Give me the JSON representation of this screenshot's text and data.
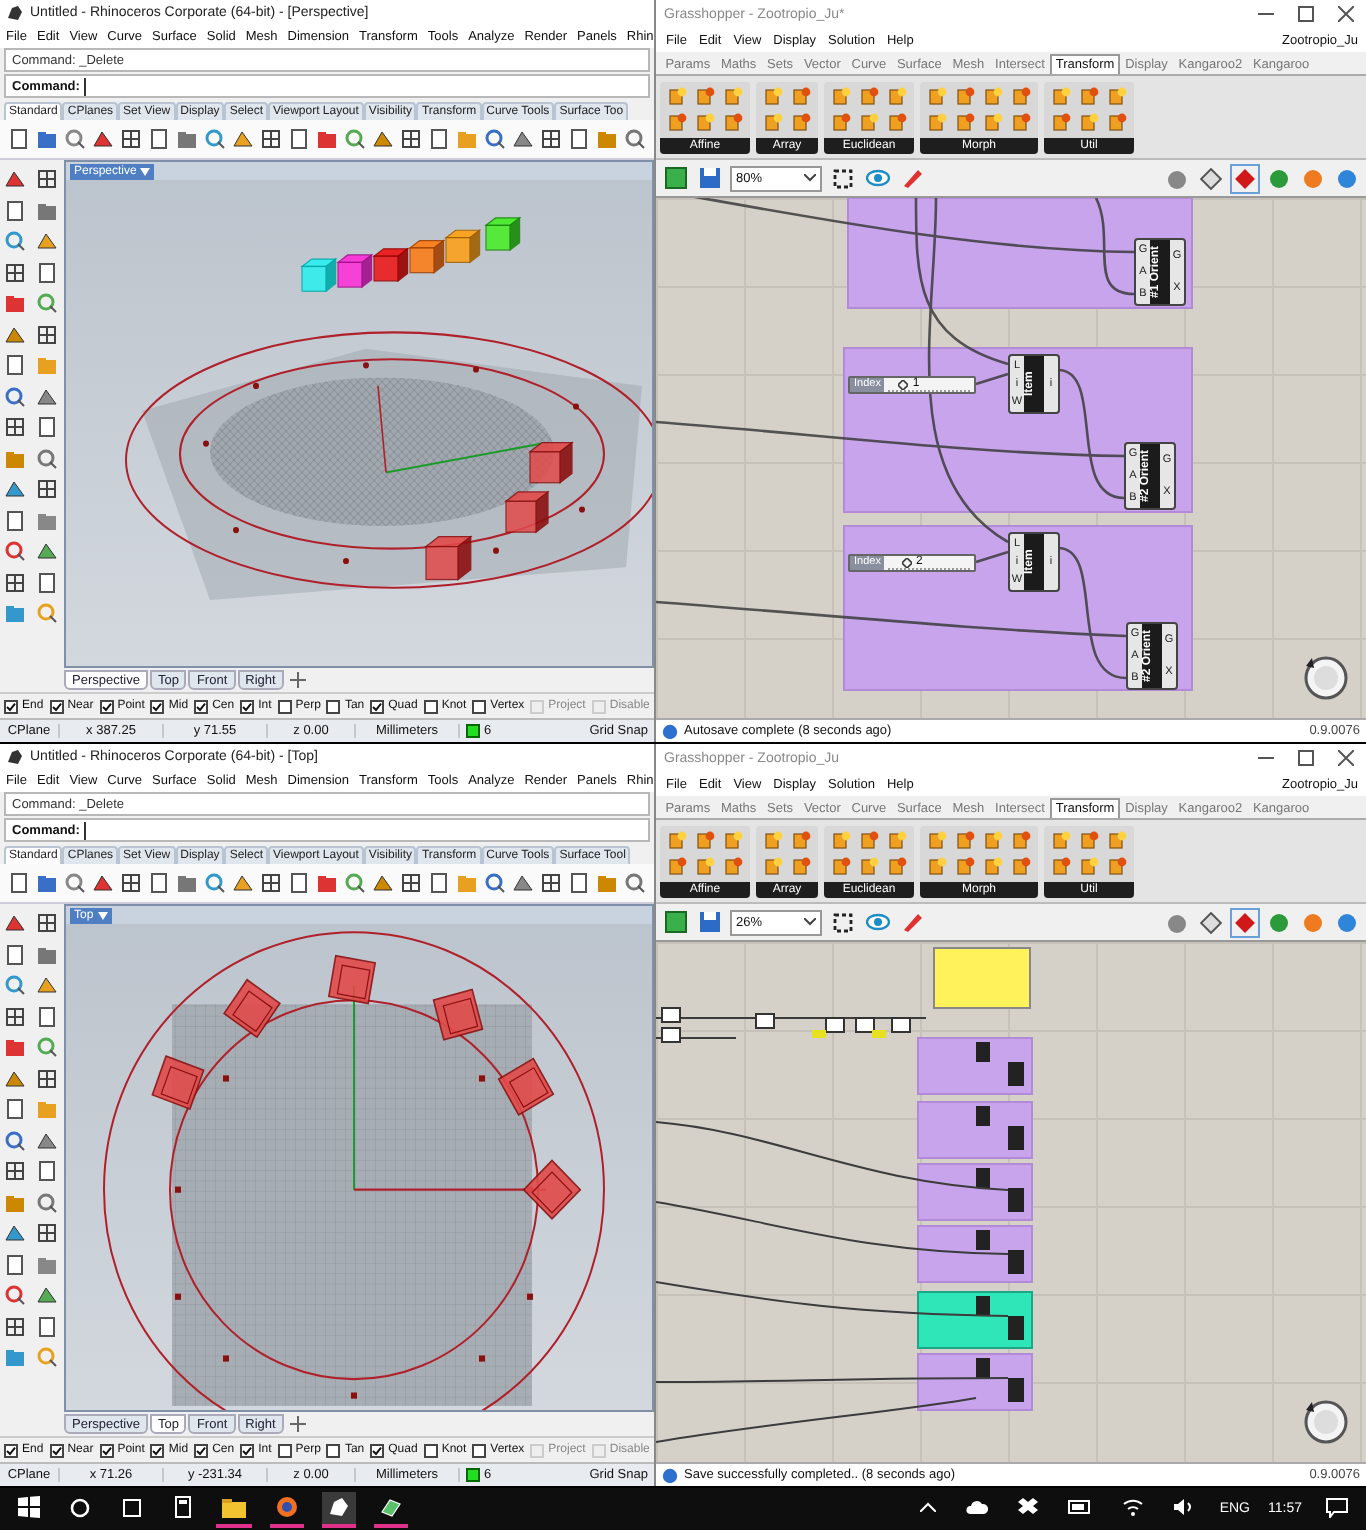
{
  "screens": [
    {
      "rhino": {
        "title": "Untitled - Rhinoceros Corporate (64-bit) - [Perspective]",
        "menu": [
          "File",
          "Edit",
          "View",
          "Curve",
          "Surface",
          "Solid",
          "Mesh",
          "Dimension",
          "Transform",
          "Tools",
          "Analyze",
          "Render",
          "Panels",
          "Rhin"
        ],
        "command_history": "Command: _Delete",
        "command_prompt": "Command:",
        "toolbar_tabs": [
          {
            "label": "Standard",
            "selected": true
          },
          {
            "label": "CPlanes",
            "selected": false
          },
          {
            "label": "Set View",
            "selected": false
          },
          {
            "label": "Display",
            "selected": false
          },
          {
            "label": "Select",
            "selected": false
          },
          {
            "label": "Viewport Layout",
            "selected": false
          },
          {
            "label": "Visibility",
            "selected": false
          },
          {
            "label": "Transform",
            "selected": false
          },
          {
            "label": "Curve Tools",
            "selected": false
          },
          {
            "label": "Surface Too",
            "selected": false
          }
        ],
        "viewport": {
          "kind": "perspective",
          "label": "Perspective"
        },
        "view_tabs": [
          {
            "label": "Perspective",
            "selected": true
          },
          {
            "label": "Top",
            "selected": false
          },
          {
            "label": "Front",
            "selected": false
          },
          {
            "label": "Right",
            "selected": false
          }
        ],
        "osnaps": [
          {
            "label": "End",
            "checked": true,
            "disabled": false
          },
          {
            "label": "Near",
            "checked": true,
            "disabled": false
          },
          {
            "label": "Point",
            "checked": true,
            "disabled": false
          },
          {
            "label": "Mid",
            "checked": true,
            "disabled": false
          },
          {
            "label": "Cen",
            "checked": true,
            "disabled": false
          },
          {
            "label": "Int",
            "checked": true,
            "disabled": false
          },
          {
            "label": "Perp",
            "checked": false,
            "disabled": false
          },
          {
            "label": "Tan",
            "checked": false,
            "disabled": false
          },
          {
            "label": "Quad",
            "checked": true,
            "disabled": false
          },
          {
            "label": "Knot",
            "checked": false,
            "disabled": false
          },
          {
            "label": "Vertex",
            "checked": false,
            "disabled": false
          },
          {
            "label": "Project",
            "checked": false,
            "disabled": true
          },
          {
            "label": "Disable",
            "checked": false,
            "disabled": true
          }
        ],
        "status": {
          "cplane": "CPlane",
          "x": "x 387.25",
          "y": "y 71.55",
          "z": "z 0.00",
          "units": "Millimeters",
          "layer": "6",
          "grid_snap": "Grid Snap"
        }
      },
      "grasshopper": {
        "title": "Grasshopper - Zootropio_Ju*",
        "menu": [
          "File",
          "Edit",
          "View",
          "Display",
          "Solution",
          "Help"
        ],
        "document": "Zootropio_Ju",
        "tabs": [
          {
            "label": "Params",
            "selected": false
          },
          {
            "label": "Maths",
            "selected": false
          },
          {
            "label": "Sets",
            "selected": false
          },
          {
            "label": "Vector",
            "selected": false
          },
          {
            "label": "Curve",
            "selected": false
          },
          {
            "label": "Surface",
            "selected": false
          },
          {
            "label": "Mesh",
            "selected": false
          },
          {
            "label": "Intersect",
            "selected": false
          },
          {
            "label": "Transform",
            "selected": true
          },
          {
            "label": "Display",
            "selected": false
          },
          {
            "label": "Kangaroo2",
            "selected": false
          },
          {
            "label": "Kangaroo",
            "selected": false
          }
        ],
        "panels": [
          "Affine",
          "Array",
          "Euclidean",
          "Morph",
          "Util"
        ],
        "zoom": "80%",
        "canvas": {
          "kind": "detailed",
          "nodes": [
            {
              "kind": "orient",
              "name": "#1 Orient",
              "inputs": [
                "G",
                "A",
                "B"
              ],
              "outputs": [
                "G",
                "X"
              ]
            },
            {
              "kind": "slider",
              "label": "Index",
              "value": "1",
              "level": 0.15
            },
            {
              "kind": "item",
              "name": "Item",
              "inputs": [
                "L",
                "i",
                "W"
              ],
              "outputs": [
                "i"
              ]
            },
            {
              "kind": "orient",
              "name": "#2 Orient",
              "inputs": [
                "G",
                "A",
                "B"
              ],
              "outputs": [
                "G",
                "X"
              ]
            },
            {
              "kind": "slider",
              "label": "Index",
              "value": "2",
              "level": 0.2
            },
            {
              "kind": "item",
              "name": "Item",
              "inputs": [
                "L",
                "i",
                "W"
              ],
              "outputs": [
                "i"
              ]
            },
            {
              "kind": "orient",
              "name": "#2 Orient",
              "inputs": [
                "G",
                "A",
                "B"
              ],
              "outputs": [
                "G",
                "X"
              ]
            }
          ]
        },
        "status": "Autosave complete (8 seconds ago)",
        "version": "0.9.0076"
      }
    },
    {
      "rhino": {
        "title": "Untitled - Rhinoceros Corporate (64-bit) - [Top]",
        "menu": [
          "File",
          "Edit",
          "View",
          "Curve",
          "Surface",
          "Solid",
          "Mesh",
          "Dimension",
          "Transform",
          "Tools",
          "Analyze",
          "Render",
          "Panels",
          "Rhin"
        ],
        "command_history": "Command: _Delete",
        "command_prompt": "Command:",
        "toolbar_tabs": [
          {
            "label": "Standard",
            "selected": true
          },
          {
            "label": "CPlanes",
            "selected": false
          },
          {
            "label": "Set View",
            "selected": false
          },
          {
            "label": "Display",
            "selected": false
          },
          {
            "label": "Select",
            "selected": false
          },
          {
            "label": "Viewport Layout",
            "selected": false
          },
          {
            "label": "Visibility",
            "selected": false
          },
          {
            "label": "Transform",
            "selected": false
          },
          {
            "label": "Curve Tools",
            "selected": false
          },
          {
            "label": "Surface Tool",
            "selected": false
          }
        ],
        "viewport": {
          "kind": "top",
          "label": "Top"
        },
        "view_tabs": [
          {
            "label": "Perspective",
            "selected": false
          },
          {
            "label": "Top",
            "selected": true
          },
          {
            "label": "Front",
            "selected": false
          },
          {
            "label": "Right",
            "selected": false
          }
        ],
        "osnaps": [
          {
            "label": "End",
            "checked": true,
            "disabled": false
          },
          {
            "label": "Near",
            "checked": true,
            "disabled": false
          },
          {
            "label": "Point",
            "checked": true,
            "disabled": false
          },
          {
            "label": "Mid",
            "checked": true,
            "disabled": false
          },
          {
            "label": "Cen",
            "checked": true,
            "disabled": false
          },
          {
            "label": "Int",
            "checked": true,
            "disabled": false
          },
          {
            "label": "Perp",
            "checked": false,
            "disabled": false
          },
          {
            "label": "Tan",
            "checked": false,
            "disabled": false
          },
          {
            "label": "Quad",
            "checked": true,
            "disabled": false
          },
          {
            "label": "Knot",
            "checked": false,
            "disabled": false
          },
          {
            "label": "Vertex",
            "checked": false,
            "disabled": false
          },
          {
            "label": "Project",
            "checked": false,
            "disabled": true
          },
          {
            "label": "Disable",
            "checked": false,
            "disabled": true
          }
        ],
        "status": {
          "cplane": "CPlane",
          "x": "x 71.26",
          "y": "y -231.34",
          "z": "z 0.00",
          "units": "Millimeters",
          "layer": "6",
          "grid_snap": "Grid Snap"
        }
      },
      "grasshopper": {
        "title": "Grasshopper - Zootropio_Ju",
        "menu": [
          "File",
          "Edit",
          "View",
          "Display",
          "Solution",
          "Help"
        ],
        "document": "Zootropio_Ju",
        "tabs": [
          {
            "label": "Params",
            "selected": false
          },
          {
            "label": "Maths",
            "selected": false
          },
          {
            "label": "Sets",
            "selected": false
          },
          {
            "label": "Vector",
            "selected": false
          },
          {
            "label": "Curve",
            "selected": false
          },
          {
            "label": "Surface",
            "selected": false
          },
          {
            "label": "Mesh",
            "selected": false
          },
          {
            "label": "Intersect",
            "selected": false
          },
          {
            "label": "Transform",
            "selected": true
          },
          {
            "label": "Display",
            "selected": false
          },
          {
            "label": "Kangaroo2",
            "selected": false
          },
          {
            "label": "Kangaroo",
            "selected": false
          }
        ],
        "panels": [
          "Affine",
          "Array",
          "Euclidean",
          "Morph",
          "Util"
        ],
        "zoom": "26%",
        "canvas": {
          "kind": "overview"
        },
        "status": "Save successfully completed.. (8 seconds ago)",
        "version": "0.9.0076"
      }
    }
  ],
  "taskbar": {
    "language": "ENG",
    "time": "11:57"
  }
}
